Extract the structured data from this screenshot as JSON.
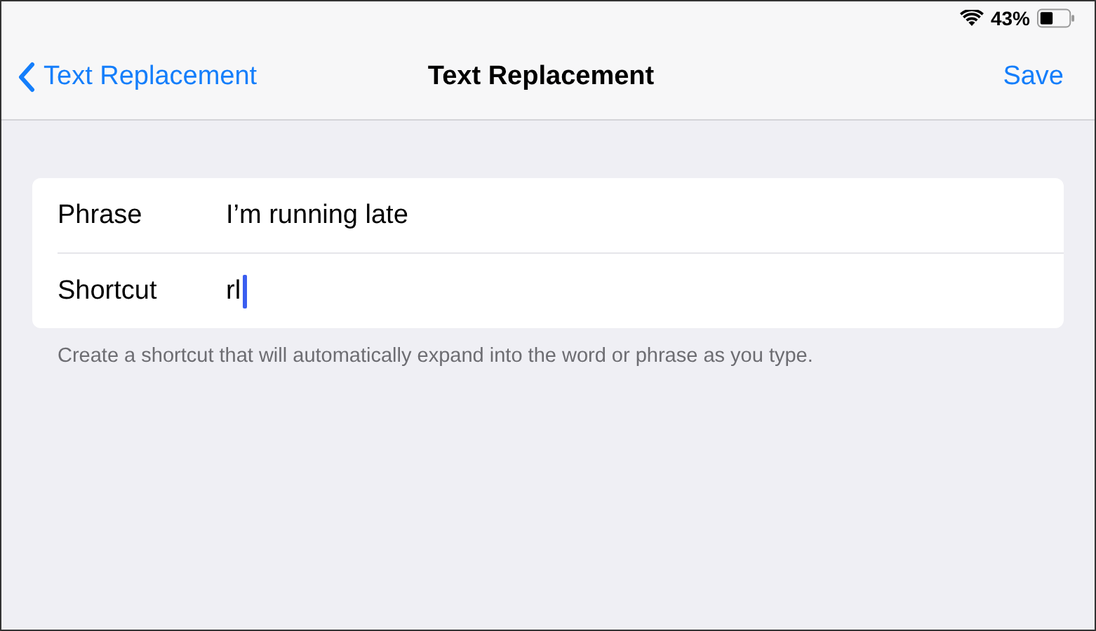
{
  "status_bar": {
    "battery": "43%"
  },
  "nav_bar": {
    "back": "Text Replacement",
    "title": "Text Replacement",
    "action": "Save"
  },
  "fields": [
    {
      "label": "Phrase",
      "value": "I’m running late",
      "focused": false
    },
    {
      "label": "Shortcut",
      "value": "rl",
      "focused": true
    }
  ],
  "footer": "Create a shortcut that will automatically expand into the word or phrase as you type."
}
